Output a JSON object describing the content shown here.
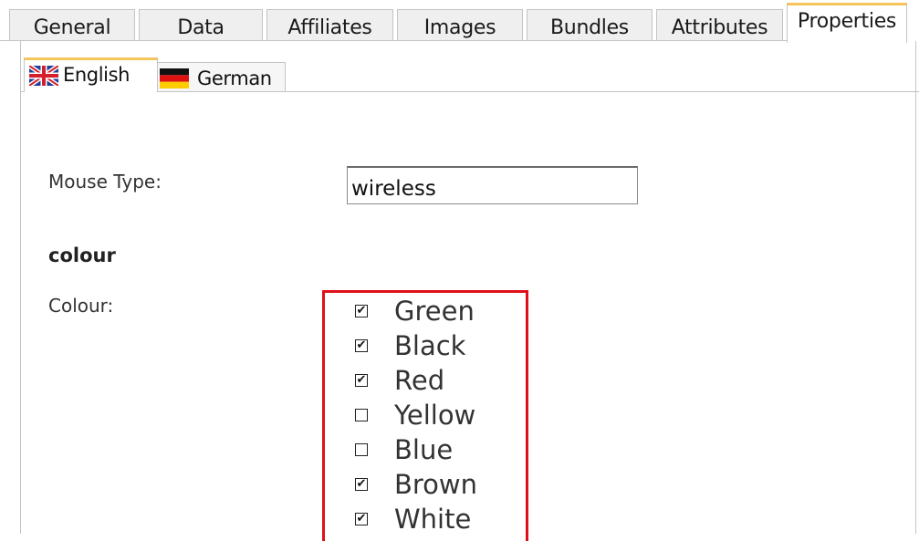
{
  "tabs": [
    {
      "label": "General",
      "active": false
    },
    {
      "label": "Data",
      "active": false
    },
    {
      "label": "Affiliates",
      "active": false
    },
    {
      "label": "Images",
      "active": false
    },
    {
      "label": "Bundles",
      "active": false
    },
    {
      "label": "Attributes",
      "active": false
    },
    {
      "label": "Properties",
      "active": true
    }
  ],
  "language_tabs": [
    {
      "label": "English",
      "flag": "uk-flag-icon",
      "active": true
    },
    {
      "label": "German",
      "flag": "germany-flag-icon",
      "active": false
    }
  ],
  "form": {
    "mouse_type_label": "Mouse Type:",
    "mouse_type_value": "wireless",
    "section_heading": "colour",
    "colour_label": "Colour:",
    "colours": [
      {
        "label": "Green",
        "checked": true
      },
      {
        "label": "Black",
        "checked": true
      },
      {
        "label": "Red",
        "checked": true
      },
      {
        "label": "Yellow",
        "checked": false
      },
      {
        "label": "Blue",
        "checked": false
      },
      {
        "label": "Brown",
        "checked": true
      },
      {
        "label": "White",
        "checked": true
      }
    ]
  },
  "colors": {
    "active_tab_accent": "#f5c45a",
    "highlight_border": "#e0101a",
    "tab_bg": "#efefef"
  }
}
